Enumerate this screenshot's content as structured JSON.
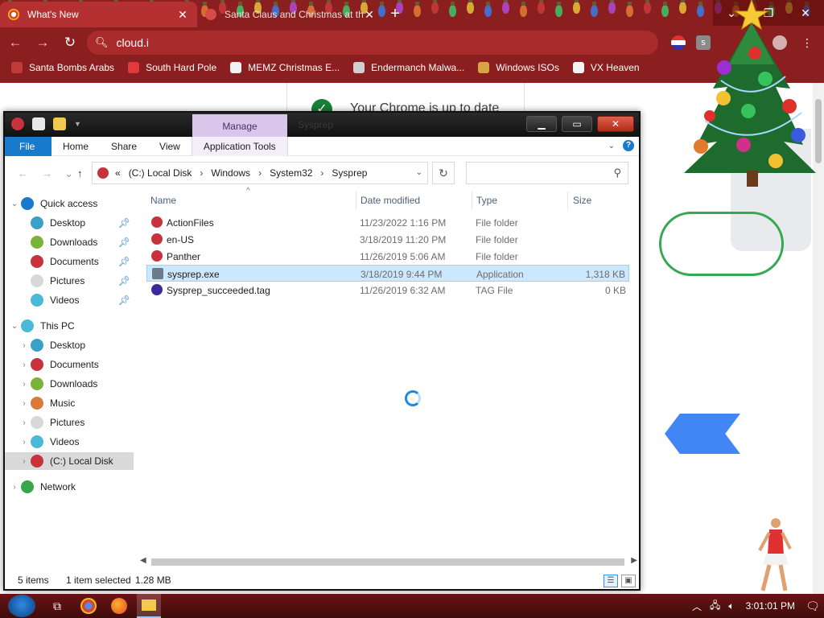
{
  "browser": {
    "tabs": [
      {
        "title": "What's New",
        "active": true,
        "favicon_color": "#e8e8e8"
      },
      {
        "title": "Santa Claus and Christmas at the",
        "active": false,
        "favicon_color": "#d94a4a"
      }
    ],
    "new_tab_glyph": "+",
    "omnibox_text": "cloud.i",
    "profile_letter": "s",
    "window_controls": {
      "minimize": "⌄",
      "restore": "❐",
      "close": "✕"
    },
    "bookmarks": [
      {
        "label": "Santa Bombs Arabs",
        "icon": "santa-icon",
        "color": "#c23b3b"
      },
      {
        "label": "South Hard Pole",
        "icon": "snowflake-icon",
        "color": "#e23a3a"
      },
      {
        "label": "MEMZ Christmas E...",
        "icon": "memz-icon",
        "color": "#f2f2f2"
      },
      {
        "label": "Endermanch Malwa...",
        "icon": "raccoon-icon",
        "color": "#cfcfcf"
      },
      {
        "label": "Windows ISOs",
        "icon": "gift-icon",
        "color": "#d9a443"
      },
      {
        "label": "VX Heaven",
        "icon": "vx-icon",
        "color": "#f4f4f4"
      }
    ]
  },
  "page": {
    "update_text": "Your Chrome is up to date"
  },
  "explorer": {
    "title": "Sysprep",
    "manage_tab": "Manage",
    "ribbon_tabs": [
      "File",
      "Home",
      "Share",
      "View",
      "Application Tools"
    ],
    "breadcrumb": {
      "overflow": "«",
      "parts": [
        "(C:) Local Disk",
        "Windows",
        "System32",
        "Sysprep"
      ]
    },
    "search_placeholder": "",
    "columns": {
      "name": "Name",
      "date": "Date modified",
      "type": "Type",
      "size": "Size"
    },
    "files": [
      {
        "name": "ActionFiles",
        "date": "11/23/2022 1:16 PM",
        "type": "File folder",
        "size": "",
        "selected": false,
        "icon_color": "#c8323c"
      },
      {
        "name": "en-US",
        "date": "3/18/2019 11:20 PM",
        "type": "File folder",
        "size": "",
        "selected": false,
        "icon_color": "#c8323c"
      },
      {
        "name": "Panther",
        "date": "11/26/2019 5:06 AM",
        "type": "File folder",
        "size": "",
        "selected": false,
        "icon_color": "#c8323c"
      },
      {
        "name": "sysprep.exe",
        "date": "3/18/2019 9:44 PM",
        "type": "Application",
        "size": "1,318 KB",
        "selected": true,
        "icon_color": "#6d7a8a"
      },
      {
        "name": "Sysprep_succeeded.tag",
        "date": "11/26/2019 6:32 AM",
        "type": "TAG File",
        "size": "0 KB",
        "selected": false,
        "icon_color": "#3b2a9a"
      }
    ],
    "nav": {
      "quick_access": "Quick access",
      "quick_items": [
        {
          "label": "Desktop",
          "color": "#3aa0c8"
        },
        {
          "label": "Downloads",
          "color": "#7ab33a"
        },
        {
          "label": "Documents",
          "color": "#c8323c"
        },
        {
          "label": "Pictures",
          "color": "#d8d8d8"
        },
        {
          "label": "Videos",
          "color": "#4ab8d8"
        }
      ],
      "this_pc": "This PC",
      "pc_items": [
        {
          "label": "Desktop",
          "color": "#3aa0c8"
        },
        {
          "label": "Documents",
          "color": "#c8323c"
        },
        {
          "label": "Downloads",
          "color": "#7ab33a"
        },
        {
          "label": "Music",
          "color": "#d87a3a"
        },
        {
          "label": "Pictures",
          "color": "#d8d8d8"
        },
        {
          "label": "Videos",
          "color": "#4ab8d8"
        },
        {
          "label": "(C:) Local Disk",
          "color": "#c8323c"
        }
      ],
      "network": "Network"
    },
    "status": {
      "items": "5 items",
      "selected": "1 item selected",
      "size": "1.28 MB"
    }
  },
  "taskbar": {
    "clock": "3:01:01 PM"
  },
  "colors": {
    "chrome_frame": "#8b1e1e",
    "active_tab": "#b53030",
    "file_tab": "#1979ca",
    "selection": "#cce8ff",
    "manage_tab": "#d9c6ea",
    "taskbar": "#5a1010"
  }
}
